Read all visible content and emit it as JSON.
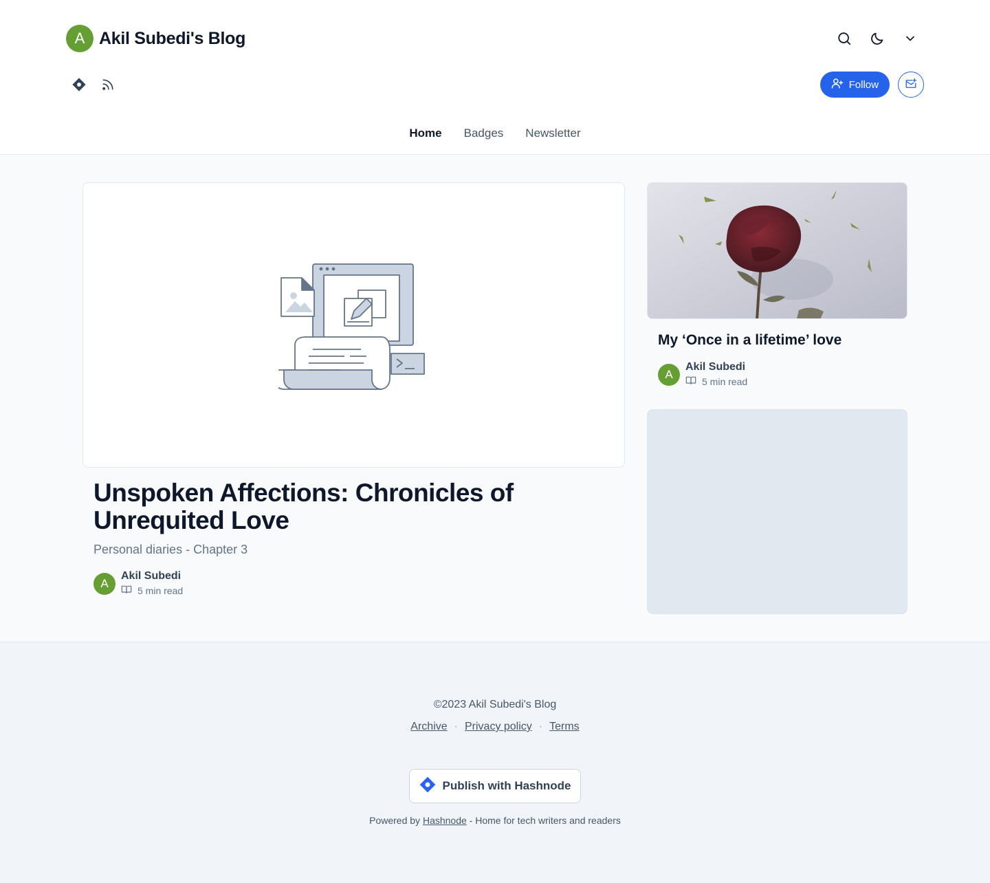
{
  "header": {
    "avatar_letter": "A",
    "blog_title": "Akil Subedi's Blog",
    "follow_label": "Follow",
    "nav": [
      {
        "label": "Home",
        "active": true
      },
      {
        "label": "Badges",
        "active": false
      },
      {
        "label": "Newsletter",
        "active": false
      }
    ]
  },
  "featured": {
    "title": "Unspoken Affections: Chronicles of Unrequited Love",
    "subtitle": "Personal diaries - Chapter 3",
    "author": "Akil Subedi",
    "avatar_letter": "A",
    "read_time": "5 min read"
  },
  "side_post": {
    "title": "My ‘Once in a lifetime’ love",
    "author": "Akil Subedi",
    "avatar_letter": "A",
    "read_time": "5 min read"
  },
  "footer": {
    "copyright": "©2023 Akil Subedi's Blog",
    "links": [
      "Archive",
      "Privacy policy",
      "Terms"
    ],
    "separator": "·",
    "publish_label": "Publish with Hashnode",
    "powered_prefix": "Powered by",
    "powered_link": "Hashnode",
    "powered_suffix": "- Home for tech writers and readers"
  },
  "colors": {
    "accent": "#2563eb",
    "avatar": "#659f33",
    "background": "#f8fafc",
    "footer_background": "#f1f5f9"
  },
  "icons": [
    "hashnode-icon",
    "rss-icon",
    "search-icon",
    "moon-icon",
    "chevron-down-icon",
    "user-plus-icon",
    "mail-plus-icon",
    "book-open-icon"
  ]
}
